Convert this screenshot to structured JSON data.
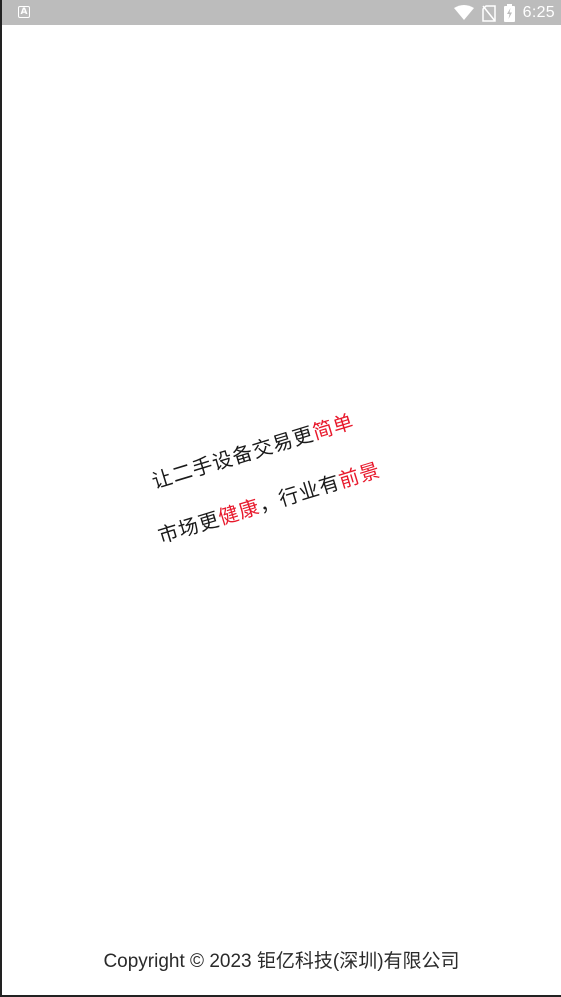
{
  "status_bar": {
    "notification_icon": "A",
    "time": "6:25",
    "icons": [
      "wifi-icon",
      "no-sim-icon",
      "battery-charging-icon"
    ]
  },
  "slogan": {
    "line1_prefix": "让二手设备交易更",
    "line1_highlight": "简单",
    "line2_prefix": "市场更",
    "line2_highlight1": "健康",
    "line2_middle": "，行业有",
    "line2_highlight2": "前景"
  },
  "footer": {
    "copyright": "Copyright © 2023 钜亿科技(深圳)有限公司"
  },
  "colors": {
    "status_bar_bg": "#bcbcbc",
    "highlight_red": "#e8192c",
    "text_dark": "#1a1a1a"
  }
}
